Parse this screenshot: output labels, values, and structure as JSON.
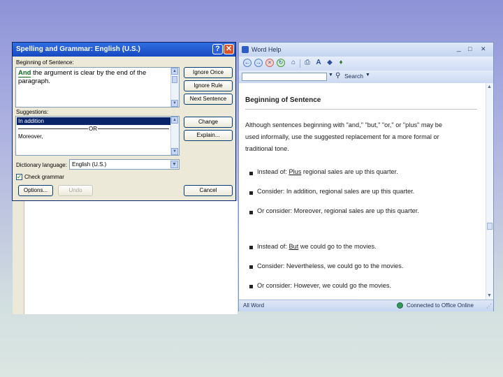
{
  "spelling_dialog": {
    "title": "Spelling and Grammar: English (U.S.)",
    "help_btn": "?",
    "close_btn": "✕",
    "issue_label": "Beginning of Sentence:",
    "sentence_flagged": "And",
    "sentence_rest_line1": " the argument is clear by the end of the",
    "sentence_line2": "paragraph.",
    "suggestions_label": "Suggestions:",
    "suggestions": [
      "In addition",
      "OR",
      "Moreover,"
    ],
    "dictionary_label": "Dictionary language:",
    "dictionary_value": "English (U.S.)",
    "check_grammar_label": "Check grammar",
    "check_grammar_checked": true,
    "buttons": {
      "ignore_once": "Ignore Once",
      "ignore_rule": "Ignore Rule",
      "next_sentence": "Next Sentence",
      "change": "Change",
      "explain": "Explain...",
      "options": "Options...",
      "undo": "Undo",
      "cancel": "Cancel"
    }
  },
  "help_window": {
    "title": "Word Help",
    "search_button": "Search",
    "search_value": "",
    "heading": "Beginning of Sentence",
    "intro_line1": "Although sentences beginning with \"and,\" \"but,\" \"or,\" or \"plus\" may be",
    "intro_line2": "used informally, use the suggested replacement for a more formal or",
    "intro_line3": "traditional tone.",
    "group1": [
      {
        "pre": "Instead of: ",
        "word": "Plus",
        "post": " regional sales are up this quarter."
      },
      {
        "pre": "Consider: In addition, regional sales are up this quarter.",
        "word": "",
        "post": ""
      },
      {
        "pre": "Or consider: Moreover, regional sales are up this quarter.",
        "word": "",
        "post": ""
      }
    ],
    "group2": [
      {
        "pre": "Instead of: ",
        "word": "But",
        "post": " we could go to the movies."
      },
      {
        "pre": "Consider: Nevertheless, we could go to the movies.",
        "word": "",
        "post": ""
      },
      {
        "pre": "Or consider: However, we could go the movies.",
        "word": "",
        "post": ""
      }
    ],
    "status_left": "All Word",
    "status_right": "Connected to Office Online",
    "toolbar_icons": [
      "back-icon",
      "forward-icon",
      "stop-icon",
      "refresh-icon",
      "home-icon",
      "print-icon",
      "font-size-icon",
      "toc-icon",
      "keep-on-top-icon"
    ],
    "window_buttons": [
      "_",
      "□",
      "✕"
    ]
  },
  "colors": {
    "dialog_title": "#1748c0",
    "dialog_face": "#ece9d8",
    "selection": "#0a246a",
    "help_title": "#c4d5f0"
  }
}
